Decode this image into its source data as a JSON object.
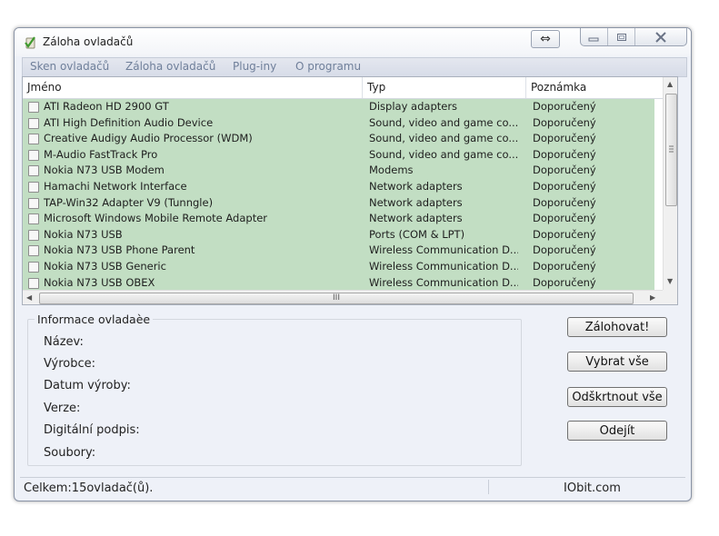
{
  "window": {
    "title": "Záloha ovladačů",
    "resize_symbol": "⇔"
  },
  "menu": [
    "Sken ovladačů",
    "Záloha ovladačů",
    "Plug-iny",
    "O programu"
  ],
  "list": {
    "columns": [
      "Jméno",
      "Typ",
      "Poznámka"
    ],
    "rows": [
      {
        "name": "ATI Radeon HD 2900 GT",
        "type": "Display adapters",
        "note": "Doporučený"
      },
      {
        "name": "ATI High Definition Audio Device",
        "type": "Sound, video and game co...",
        "note": "Doporučený"
      },
      {
        "name": "Creative Audigy Audio Processor (WDM)",
        "type": "Sound, video and game co...",
        "note": "Doporučený"
      },
      {
        "name": "M-Audio FastTrack Pro",
        "type": "Sound, video and game co...",
        "note": "Doporučený"
      },
      {
        "name": "Nokia N73 USB Modem",
        "type": "Modems",
        "note": "Doporučený"
      },
      {
        "name": "Hamachi Network Interface",
        "type": "Network adapters",
        "note": "Doporučený"
      },
      {
        "name": "TAP-Win32 Adapter V9 (Tunngle)",
        "type": "Network adapters",
        "note": "Doporučený"
      },
      {
        "name": "Microsoft Windows Mobile Remote Adapter",
        "type": "Network adapters",
        "note": "Doporučený"
      },
      {
        "name": "Nokia N73 USB",
        "type": "Ports (COM & LPT)",
        "note": "Doporučený"
      },
      {
        "name": "Nokia N73 USB Phone Parent",
        "type": "Wireless Communication D...",
        "note": "Doporučený"
      },
      {
        "name": "Nokia N73 USB Generic",
        "type": "Wireless Communication D...",
        "note": "Doporučený"
      },
      {
        "name": "Nokia N73 USB OBEX",
        "type": "Wireless Communication D...",
        "note": "Doporučený"
      }
    ],
    "row_color": "#c2dec3",
    "hscroll_grip": "III"
  },
  "info": {
    "title": "Informace ovladaèe",
    "labels": [
      "Název:",
      "Výrobce:",
      "Datum výroby:",
      "Verze:",
      "Digitální podpis:",
      "Soubory:"
    ]
  },
  "buttons": {
    "backup": "Zálohovat!",
    "select_all": "Vybrat vše",
    "deselect_all": "Odškrtnout vše",
    "exit": "Odejít"
  },
  "status": {
    "count": "Celkem:15ovladač(ů).",
    "brand": "IObit.com"
  }
}
